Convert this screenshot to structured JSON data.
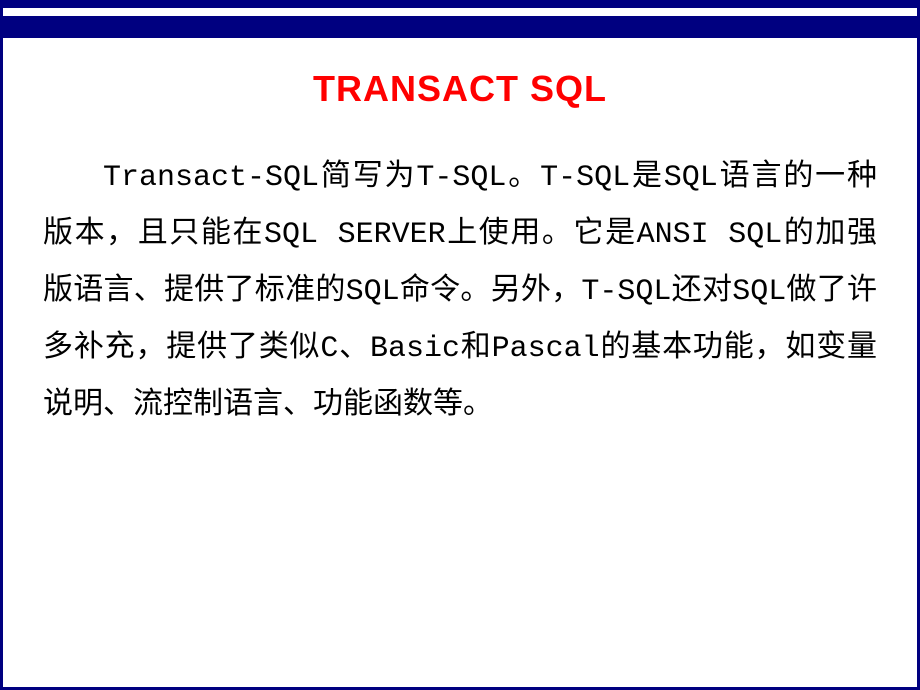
{
  "slide": {
    "title": "TRANSACT SQL",
    "body": "Transact-SQL简写为T-SQL。T-SQL是SQL语言的一种版本，且只能在SQL SERVER上使用。它是ANSI SQL的加强版语言、提供了标准的SQL命令。另外，T-SQL还对SQL做了许多补充，提供了类似C、Basic和Pascal的基本功能，如变量说明、流控制语言、功能函数等。"
  }
}
